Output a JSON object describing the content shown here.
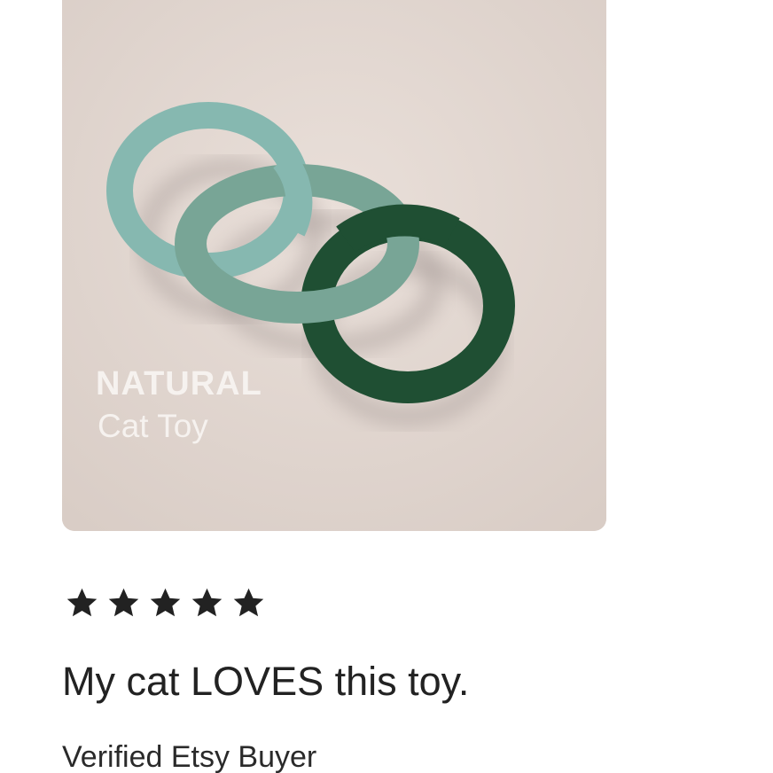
{
  "product_image": {
    "overlay_title": "NATURAL",
    "overlay_subtitle": "Cat Toy"
  },
  "review": {
    "rating": 5,
    "rating_max": 5,
    "text": "My cat LOVES this toy.",
    "reviewer": "Verified Etsy Buyer"
  },
  "colors": {
    "star": "#222222",
    "background": "#ffffff",
    "photo_background": "#e4d8d2",
    "ring_light": "#7fb0a8",
    "ring_mid": "#73a08f",
    "ring_dark": "#1f4f33"
  },
  "icons": {
    "star": "star-icon"
  }
}
